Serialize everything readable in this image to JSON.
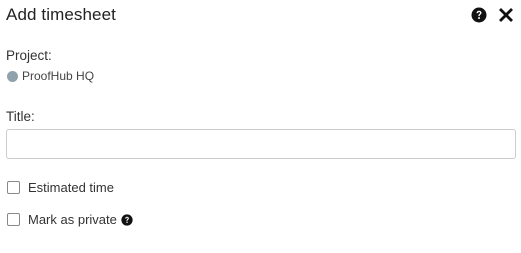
{
  "dialog": {
    "title": "Add timesheet",
    "help_icon": "question-circle-icon",
    "close_icon": "close-icon"
  },
  "project": {
    "label": "Project:",
    "value": "ProofHub HQ",
    "dot_color": "#8fa1ad"
  },
  "title_field": {
    "label": "Title:",
    "value": "",
    "placeholder": ""
  },
  "options": {
    "estimated_time": {
      "label": "Estimated time",
      "checked": false
    },
    "mark_private": {
      "label": "Mark as private",
      "checked": false,
      "help_icon": "question-circle-icon"
    }
  },
  "colors": {
    "text": "#333333",
    "border": "#cccccc",
    "icon": "#111111"
  }
}
